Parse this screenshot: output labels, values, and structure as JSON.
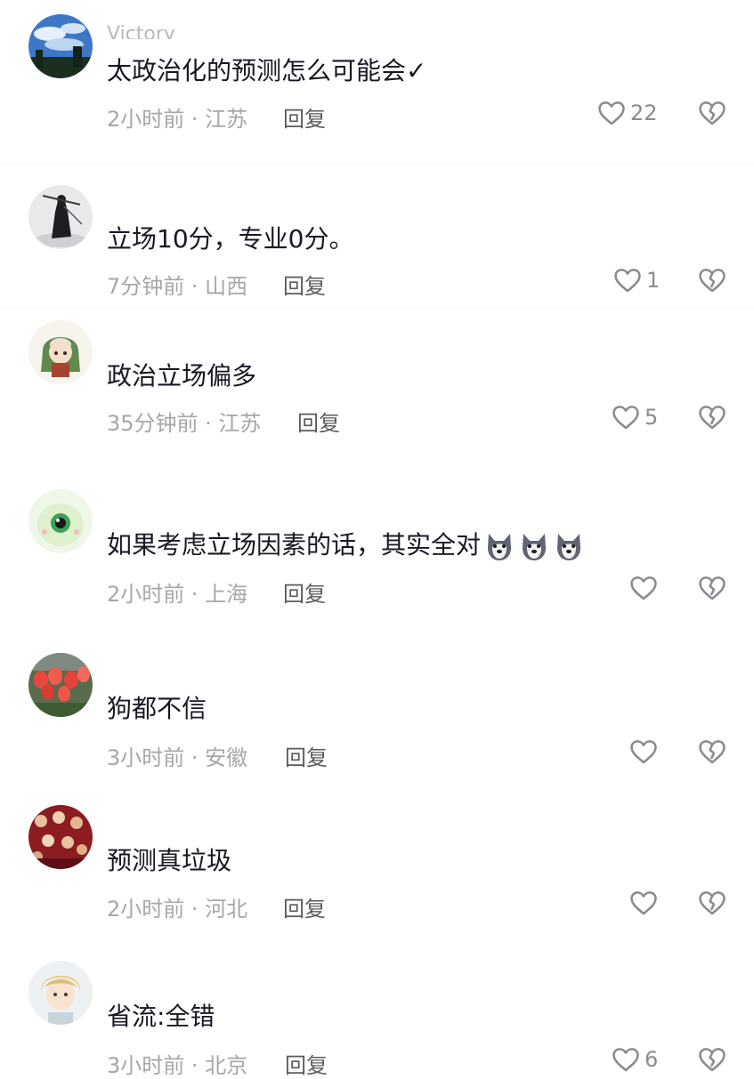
{
  "comments": [
    {
      "username": "Victory",
      "text": "太政治化的预测怎么可能会✓",
      "meta": "2小时前 · 江苏",
      "reply": "回复",
      "likes": "22",
      "avatar": "sky-cityscape"
    },
    {
      "username": "",
      "text": "立场10分，专业0分。",
      "meta": "7分钟前 · 山西",
      "reply": "回复",
      "likes": "1",
      "avatar": "ink-swordsman"
    },
    {
      "username": "",
      "text": "政治立场偏多",
      "meta": "35分钟前 · 江苏",
      "reply": "回复",
      "likes": "5",
      "avatar": "anime-girl-green-hood"
    },
    {
      "username": "",
      "text": "如果考虑立场因素的话，其实全对",
      "emoji": [
        "husky-dog-emoji",
        "husky-dog-emoji",
        "husky-dog-emoji"
      ],
      "meta": "2小时前 · 上海",
      "reply": "回复",
      "likes": "",
      "avatar": "green-monster"
    },
    {
      "username": "",
      "text": "狗都不信",
      "meta": "3小时前 · 安徽",
      "reply": "回复",
      "likes": "",
      "avatar": "red-tulips"
    },
    {
      "username": "",
      "text": "预测真垃圾",
      "meta": "2小时前 · 河北",
      "reply": "回复",
      "likes": "",
      "avatar": "crowd-red"
    },
    {
      "username": "",
      "text": "省流:全错",
      "meta": "3小时前 · 北京",
      "reply": "回复",
      "likes": "6",
      "avatar": "anime-boy-blonde"
    }
  ],
  "colors": {
    "text": "#161823",
    "meta": "#a6a6ab",
    "reply": "#5a5a60",
    "icon": "#8a8a90"
  }
}
